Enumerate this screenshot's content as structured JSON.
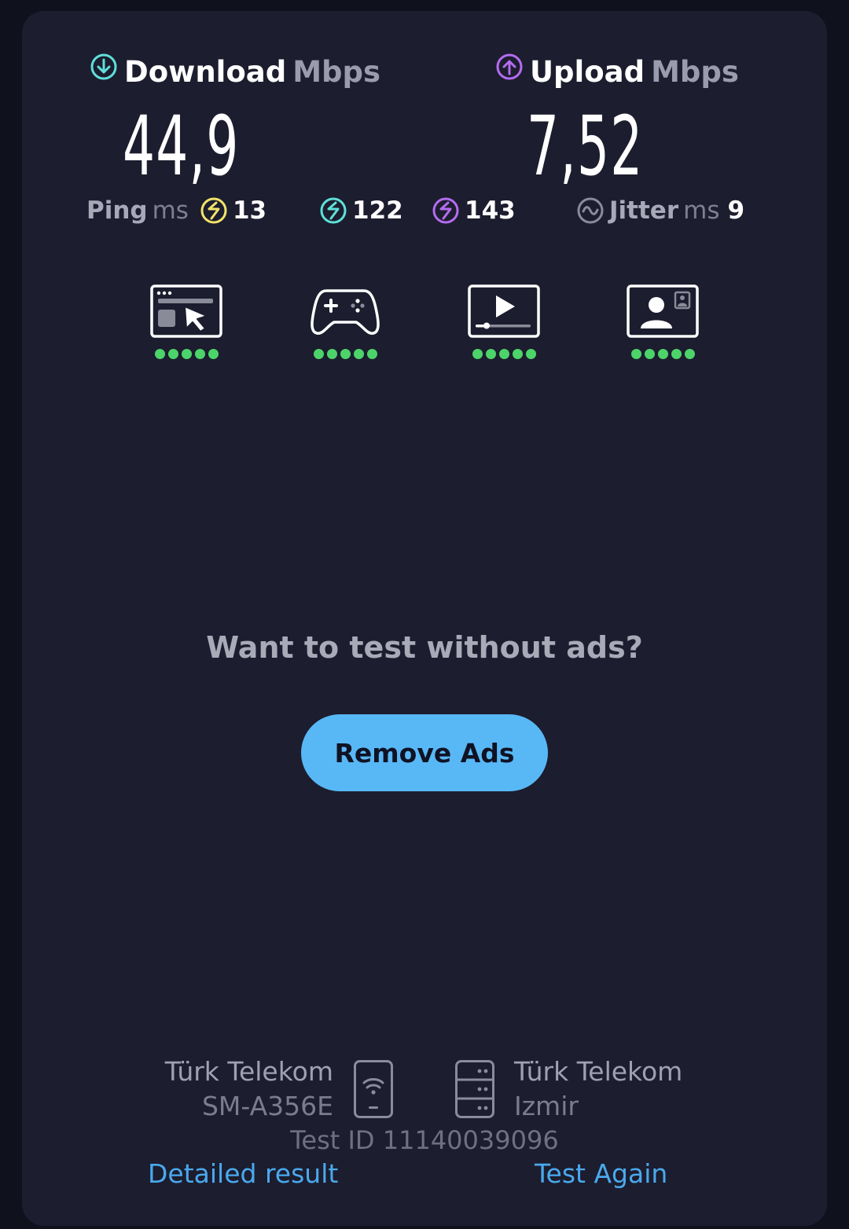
{
  "download": {
    "label": "Download",
    "unit": "Mbps",
    "value": "44,9",
    "icon": "download-arrow-circle-icon",
    "color": "#5fe0d8"
  },
  "upload": {
    "label": "Upload",
    "unit": "Mbps",
    "value": "7,52",
    "icon": "upload-arrow-circle-icon",
    "color": "#b46cf0"
  },
  "ping": {
    "label": "Ping",
    "unit": "ms",
    "idle": {
      "value": "13",
      "color": "#f3e36b"
    },
    "download": {
      "value": "122",
      "color": "#5fe0d8"
    },
    "upload": {
      "value": "143",
      "color": "#b46cf0"
    }
  },
  "jitter": {
    "label": "Jitter",
    "unit": "ms",
    "value": "9"
  },
  "quality": [
    {
      "icon": "web-browsing-icon",
      "rating": 5
    },
    {
      "icon": "gaming-controller-icon",
      "rating": 5
    },
    {
      "icon": "video-streaming-icon",
      "rating": 5
    },
    {
      "icon": "video-call-icon",
      "rating": 5
    }
  ],
  "promo": {
    "text": "Want to test without ads?",
    "button": "Remove Ads",
    "button_color": "#58b8f5"
  },
  "client": {
    "provider": "Türk Telekom",
    "device": "SM-A356E",
    "icon": "phone-wifi-icon"
  },
  "server": {
    "provider": "Türk Telekom",
    "location": "Izmir",
    "icon": "server-icon"
  },
  "test_id": "Test ID 11140039096",
  "links": {
    "detailed": "Detailed result",
    "again": "Test Again"
  }
}
